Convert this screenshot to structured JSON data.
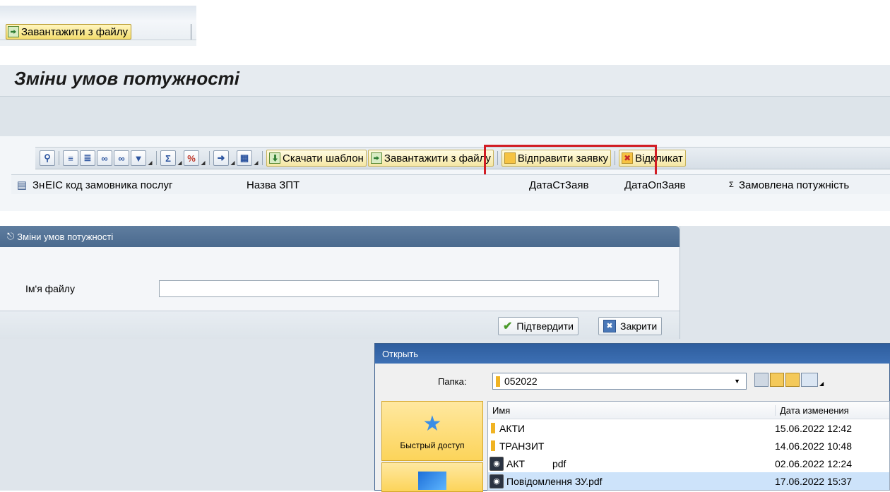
{
  "snippet": {
    "upload_label": "Завантажити з файлу"
  },
  "page_title": "Зміни умов потужності",
  "toolbar": {
    "download_template_label": "Скачати шаблон",
    "upload_label": "Завантажити з файлу",
    "send_request_label": "Відправити заявку",
    "revoke_label": "Відкликат"
  },
  "columns": {
    "change": "Зн",
    "eic": "EIC код замовника послуг",
    "zpt_name": "Назва ЗПТ",
    "date_start": "ДатаСтЗаяв",
    "date_op": "ДатаОпЗаяв",
    "sum_marker": "Ʃ",
    "ordered_power": "Замовлена потужність"
  },
  "dialog": {
    "title": "Зміни умов потужності",
    "file_label": "Ім'я файлу",
    "file_value": "",
    "confirm_label": "Підтвердити",
    "close_label": "Закрити"
  },
  "open_dialog": {
    "title": "Открыть",
    "folder_label": "Папка:",
    "folder_value": "052022",
    "quick_access_label": "Быстрый доступ",
    "col_name": "Имя",
    "col_date": "Дата изменения",
    "files": [
      {
        "name": "АКТИ",
        "date": "15.06.2022 12:42",
        "type": "folder"
      },
      {
        "name": "ТРАНЗИТ",
        "date": "14.06.2022 10:48",
        "type": "folder"
      },
      {
        "name": "АКТ          pdf",
        "date": "02.06.2022 12:24",
        "type": "pdf"
      },
      {
        "name": "Повідомлення ЗУ.pdf",
        "date": "17.06.2022 15:37",
        "type": "pdf"
      }
    ]
  }
}
